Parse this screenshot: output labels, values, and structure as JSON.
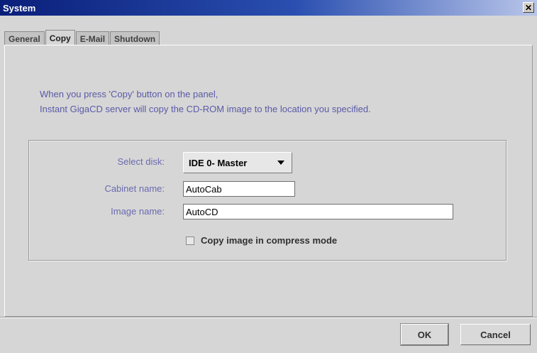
{
  "window": {
    "title": "System",
    "close_glyph": "✕"
  },
  "tabs": [
    {
      "label": "General"
    },
    {
      "label": "Copy",
      "active": true
    },
    {
      "label": "E-Mail"
    },
    {
      "label": "Shutdown"
    }
  ],
  "description": {
    "line1": "When you press 'Copy' button on the panel,",
    "line2": "Instant GigaCD server will copy the CD-ROM image to the location you specified."
  },
  "form": {
    "select_disk_label": "Select disk:",
    "select_disk_value": "IDE 0- Master",
    "cabinet_name_label": "Cabinet name:",
    "cabinet_name_value": "AutoCab",
    "image_name_label": "Image name:",
    "image_name_value": "AutoCD",
    "compress_label": "Copy image in compress mode",
    "compress_checked": false
  },
  "buttons": {
    "ok": "OK",
    "cancel": "Cancel"
  },
  "colors": {
    "label_text": "#6a6ab0",
    "description_text": "#5a5aa8",
    "title_bar": "#0a1f7a"
  },
  "icons": {
    "dropdown": "chevron-down-icon",
    "close": "close-icon"
  }
}
